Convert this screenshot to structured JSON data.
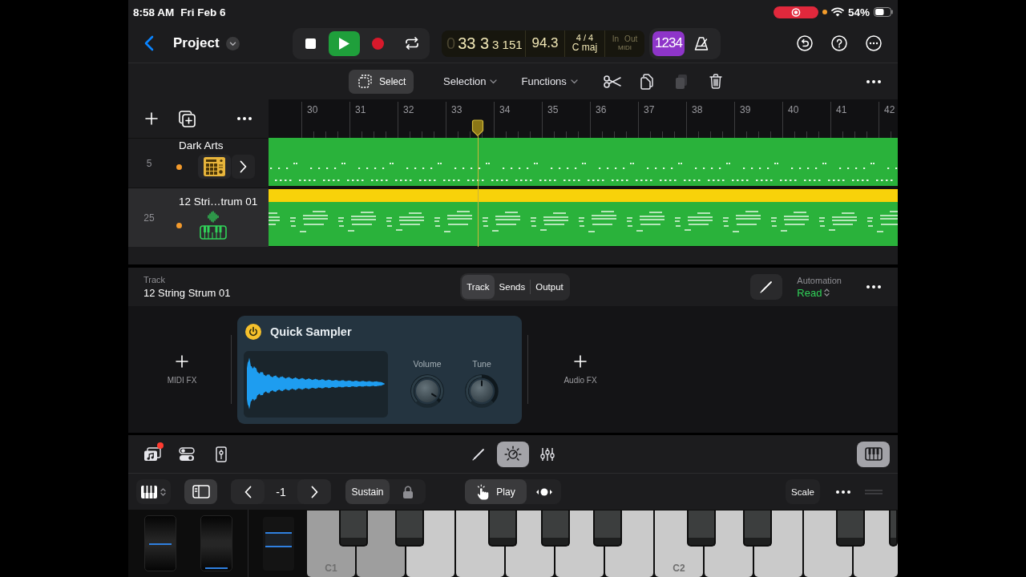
{
  "status_bar": {
    "time": "8:58 AM",
    "date": "Fri Feb 6",
    "battery": "54%"
  },
  "control_bar": {
    "title": "Project",
    "transport": [
      {
        "kind": "stop",
        "on": false
      },
      {
        "kind": "play",
        "on": true
      },
      {
        "kind": "record",
        "on": false
      },
      {
        "kind": "cycle",
        "on": false
      }
    ],
    "lcd": {
      "position_lead": "0",
      "position": "33 3",
      "position_sub": "3 151",
      "tempo": "94.3",
      "time_signature": "4 / 4",
      "key": "C maj",
      "midi": {
        "in": "In",
        "out": "Out",
        "label": "MIDI",
        "active": false
      }
    },
    "count_in": {
      "label": "1234",
      "on": true
    },
    "metronome": {
      "on": false
    }
  },
  "edit_toolbar": {
    "select": {
      "label": "Select",
      "selected": true
    },
    "menus": [
      "Selection",
      "Functions"
    ],
    "tools": [
      {
        "kind": "cut",
        "disabled": false
      },
      {
        "kind": "copy",
        "disabled": false
      },
      {
        "kind": "paste",
        "disabled": true
      },
      {
        "kind": "delete",
        "disabled": false
      }
    ]
  },
  "ruler": {
    "bars": [
      "30",
      "31",
      "32",
      "33",
      "34",
      "35",
      "36",
      "37",
      "38",
      "39",
      "40",
      "41",
      "42"
    ],
    "playhead": {
      "level": 0.3325
    }
  },
  "tracks": [
    {
      "number": "5",
      "name": "Dark Arts",
      "kind": "drummer",
      "selected": false,
      "region": {
        "selected": false
      }
    },
    {
      "number": "25",
      "name": "12 Stri…trum 01",
      "kind": "keys",
      "selected": true,
      "region": {
        "selected": true
      }
    }
  ],
  "inspector": {
    "label": "Track",
    "track_name": "12 String Strum 01",
    "tabs": [
      {
        "label": "Track",
        "selected": true
      },
      {
        "label": "Sends",
        "selected": false
      },
      {
        "label": "Output",
        "selected": false
      }
    ],
    "automation": {
      "label": "Automation",
      "value": "Read"
    },
    "slots": [
      {
        "kind": "add",
        "label": "MIDI FX"
      },
      {
        "kind": "plugin",
        "title": "Quick Sampler",
        "on": true,
        "knobs": [
          {
            "label": "Volume",
            "level": 0.95
          },
          {
            "label": "Tune",
            "level": 0.5
          }
        ]
      },
      {
        "kind": "add",
        "label": "Audio FX"
      }
    ]
  },
  "bottom_toolbar": {
    "left": [
      {
        "kind": "browser",
        "selected": false,
        "badge": true
      },
      {
        "kind": "toggles",
        "selected": false,
        "badge": false
      },
      {
        "kind": "fader",
        "selected": false,
        "badge": false
      }
    ],
    "center": [
      {
        "kind": "pencil",
        "selected": false
      },
      {
        "kind": "dial",
        "selected": true
      },
      {
        "kind": "mixer",
        "selected": false
      }
    ],
    "right": [
      {
        "kind": "keyboard",
        "selected": true
      }
    ]
  },
  "keyboard_controls": {
    "sidebar": {
      "selected": true
    },
    "octave": "-1",
    "sustain": "Sustain",
    "modes": [
      {
        "kind": "play",
        "label": "Play",
        "selected": true
      },
      {
        "kind": "glide",
        "selected": false
      }
    ],
    "scale": "Scale"
  },
  "keyboard": {
    "wheels": [
      {
        "level": 0.5
      },
      {
        "level": 0
      }
    ],
    "white_keys": [
      {
        "label": "C1",
        "pressed": true
      },
      {
        "pressed": true
      },
      {
        "pressed": false
      },
      {
        "pressed": false
      },
      {
        "pressed": false
      },
      {
        "pressed": false
      },
      {
        "pressed": false
      },
      {
        "label": "C2",
        "pressed": false
      },
      {
        "pressed": false
      },
      {
        "pressed": false
      },
      {
        "pressed": false
      },
      {
        "pressed": false
      }
    ]
  }
}
